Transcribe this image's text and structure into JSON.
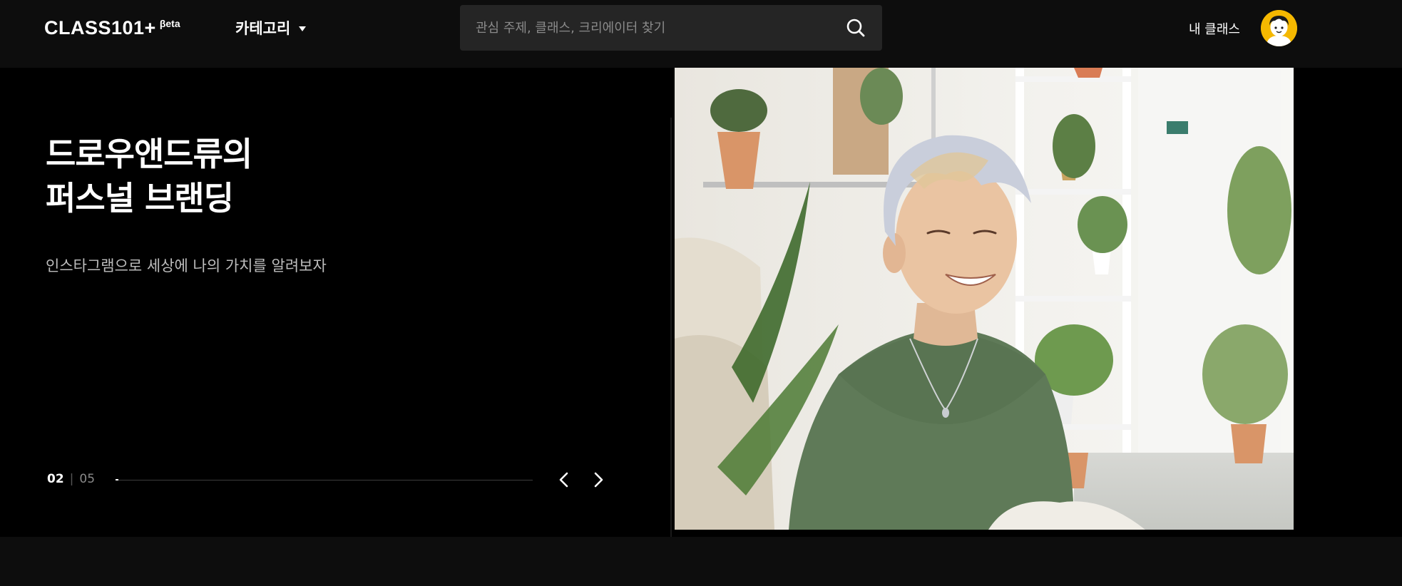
{
  "header": {
    "logo": "CLASS101+",
    "logo_badge": "βeta",
    "category_label": "카테고리",
    "search_placeholder": "관심 주제, 클래스, 크리에이터 찾기",
    "my_class_label": "내 클래스"
  },
  "hero": {
    "title_line1": "드로우앤드류의",
    "title_line2": "퍼스널 브랜딩",
    "subtitle": "인스타그램으로 세상에 나의 가치를 알려보자",
    "pager": {
      "current": "02",
      "separator": "|",
      "total": "05"
    },
    "progress_fraction": 0.007,
    "image_description": "smiling man with silver hair in green t-shirt, plants in background"
  },
  "colors": {
    "header_bg": "#0d0d0d",
    "hero_bg": "#000000",
    "search_bg": "#252525",
    "avatar_bg": "#f5b800",
    "tshirt_green": "#5f7a58"
  },
  "icons": {
    "search": "search-icon",
    "caret": "caret-down-icon",
    "prev": "chevron-left-icon",
    "next": "chevron-right-icon"
  }
}
